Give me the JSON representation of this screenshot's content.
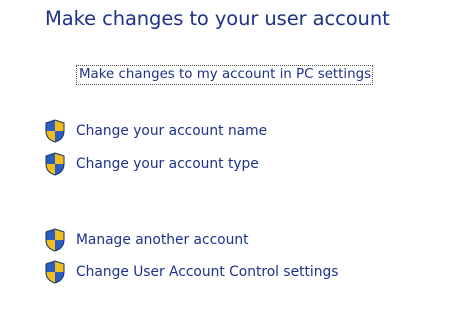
{
  "page": {
    "title": "Make changes to your user account"
  },
  "links": {
    "pc_settings": "Make changes to my account in PC settings"
  },
  "tasks": [
    {
      "label": "Change your account name",
      "icon": "uac-shield-icon"
    },
    {
      "label": "Change your account type",
      "icon": "uac-shield-icon"
    },
    {
      "label": "Manage another account",
      "icon": "uac-shield-icon"
    },
    {
      "label": "Change User Account Control settings",
      "icon": "uac-shield-icon"
    }
  ],
  "colors": {
    "link_text": "#1e3287",
    "shield_blue": "#2a5fc0",
    "shield_gold": "#f0bc1e"
  }
}
